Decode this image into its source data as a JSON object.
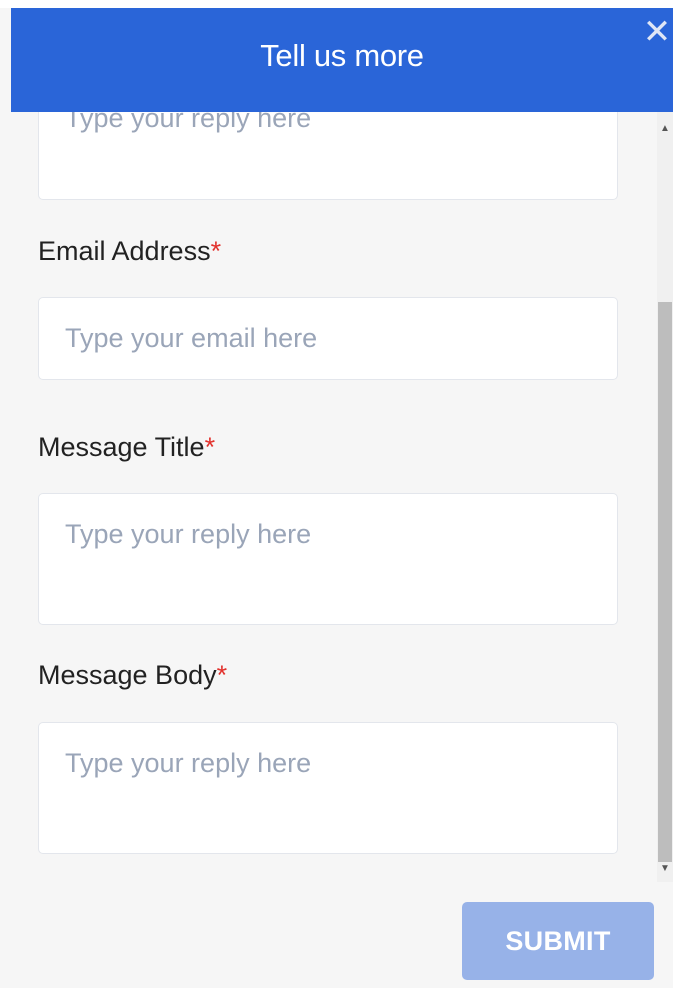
{
  "header": {
    "title": "Tell us more",
    "close_symbol": "✕"
  },
  "form": {
    "prev_field": {
      "placeholder": "Type your reply here"
    },
    "email": {
      "label": "Email Address",
      "required_mark": "*",
      "placeholder": "Type your email here"
    },
    "title": {
      "label": "Message Title",
      "required_mark": "*",
      "placeholder": "Type your reply here"
    },
    "body": {
      "label": "Message Body",
      "required_mark": "*",
      "placeholder": "Type your reply here"
    }
  },
  "scrollbar": {
    "up": "▲",
    "down": "▼"
  },
  "actions": {
    "submit_label": "SUBMIT"
  },
  "colors": {
    "header": "#2a65d8",
    "submit_disabled": "#97b2e8",
    "required": "#e2322d"
  }
}
